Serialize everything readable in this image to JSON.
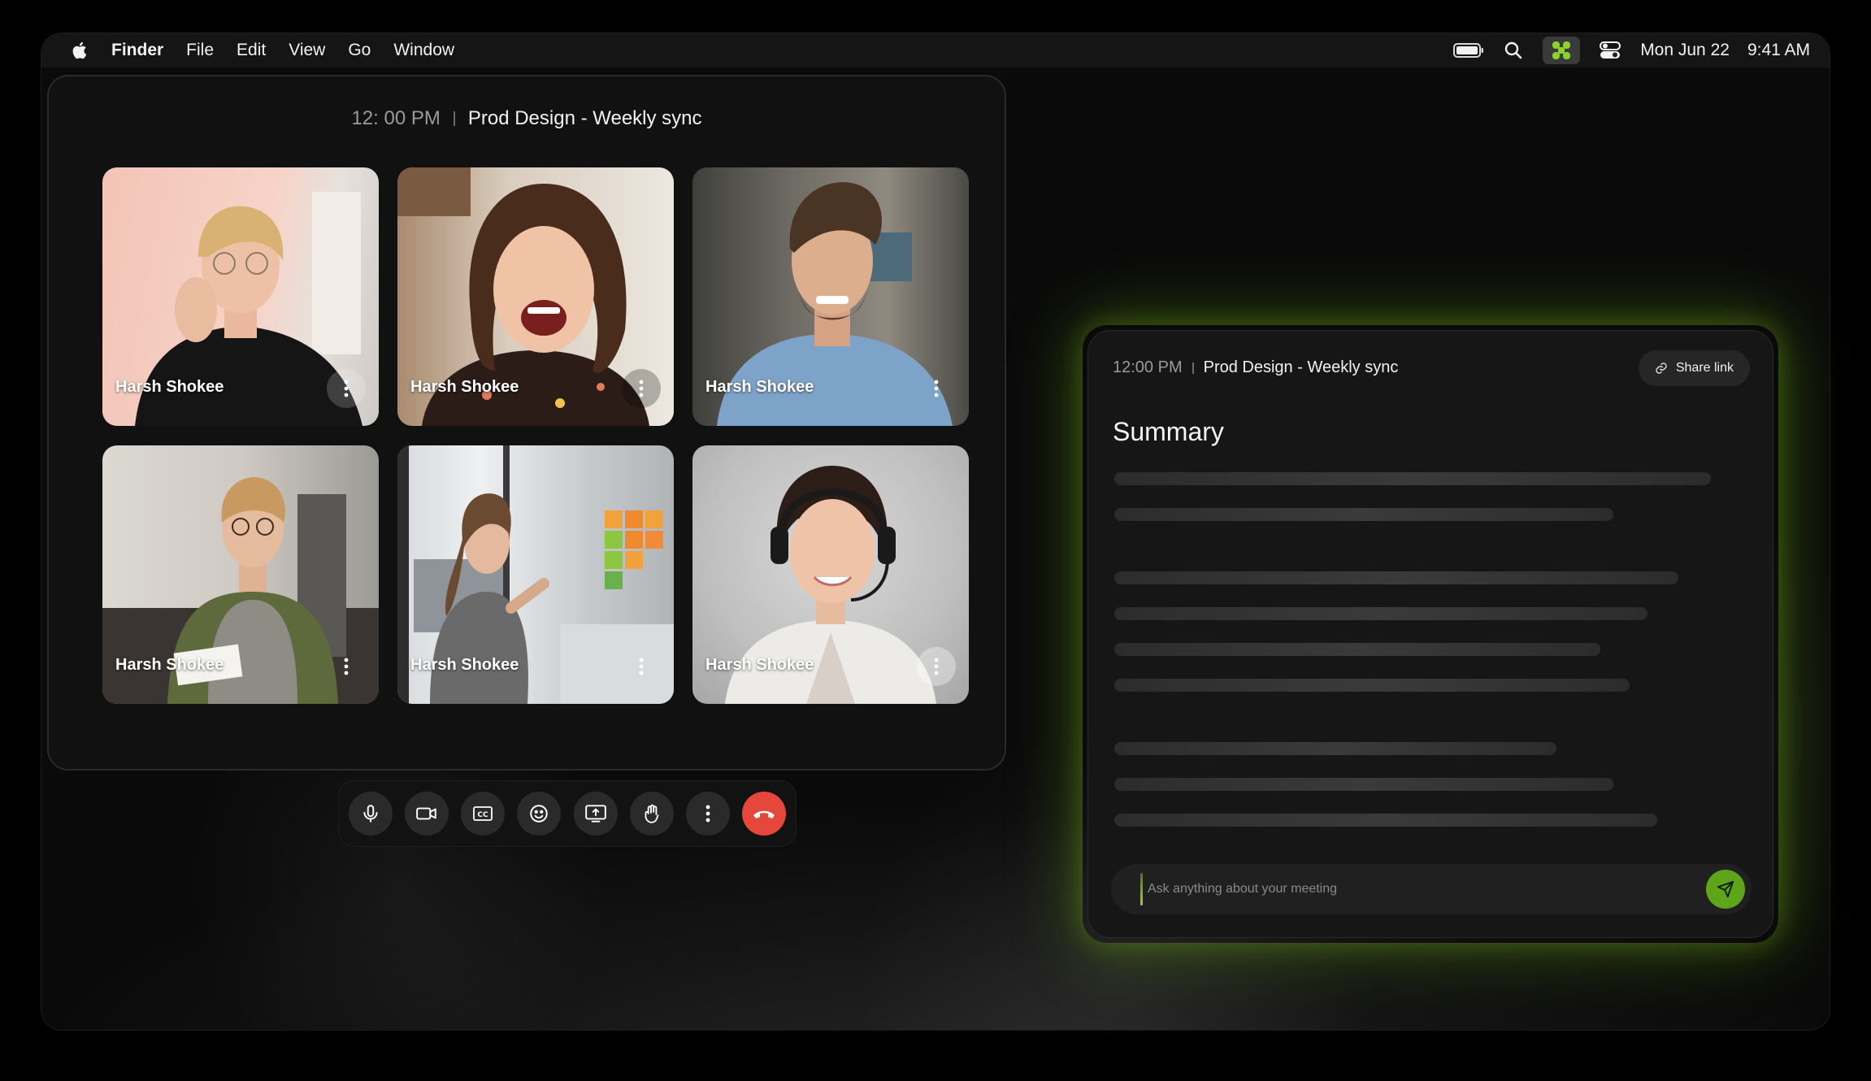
{
  "menubar": {
    "apple_icon": "apple-logo-icon",
    "app_name": "Finder",
    "items": [
      "File",
      "Edit",
      "View",
      "Go",
      "Window"
    ],
    "status_icons": [
      "battery-icon",
      "search-icon",
      "app-icon",
      "control-center-icon"
    ],
    "date": "Mon Jun 22",
    "time": "9:41 AM"
  },
  "meeting": {
    "time": "12: 00 PM",
    "title": "Prod Design - Weekly sync",
    "participants": [
      {
        "name": "Harsh Shokee"
      },
      {
        "name": "Harsh Shokee"
      },
      {
        "name": "Harsh Shokee"
      },
      {
        "name": "Harsh Shokee"
      },
      {
        "name": "Harsh Shokee"
      },
      {
        "name": "Harsh Shokee"
      }
    ],
    "controls": [
      "microphone-icon",
      "camera-icon",
      "captions-icon",
      "emoji-icon",
      "share-screen-icon",
      "raise-hand-icon",
      "more-icon",
      "end-call-icon"
    ]
  },
  "summary": {
    "time": "12:00 PM",
    "title": "Prod Design - Weekly sync",
    "share_label": "Share link",
    "heading": "Summary",
    "ask_placeholder": "Ask anything about your meeting"
  },
  "colors": {
    "accent_green": "#5fa51a",
    "end_call_red": "#e5473b",
    "panel_bg": "#161616",
    "window_bg": "#111111"
  }
}
